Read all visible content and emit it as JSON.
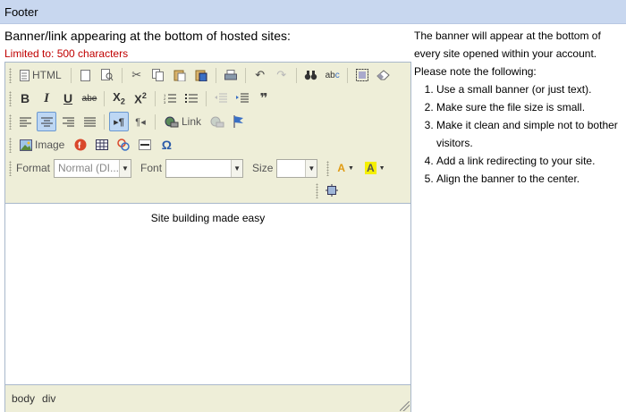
{
  "section": {
    "title": "Footer"
  },
  "form": {
    "label": "Banner/link appearing at the bottom of hosted sites:",
    "limit": "Limited to: 500 characters"
  },
  "toolbar": {
    "html_label": "HTML",
    "link_label": "Link",
    "image_label": "Image",
    "format_label": "Format",
    "format_value": "Normal (DI...",
    "font_label": "Font",
    "font_value": "",
    "size_label": "Size",
    "size_value": "",
    "active_button": "align-center"
  },
  "editor": {
    "content": "Site building made easy",
    "path": [
      "body",
      "div"
    ]
  },
  "notes": {
    "intro": "The banner will appear at the bottom of every site opened within your account. Please note the following:",
    "items": [
      "Use a small banner (or just text).",
      "Make sure the file size is small.",
      "Make it clean and simple not to bother visitors.",
      "Add a link redirecting to your site.",
      "Align the banner to the center."
    ]
  },
  "colors": {
    "header_bg": "#c8d7ef",
    "toolbar_bg": "#eeeed8",
    "limit_text": "#c00000",
    "active_button_bg": "#bdd7f4"
  }
}
